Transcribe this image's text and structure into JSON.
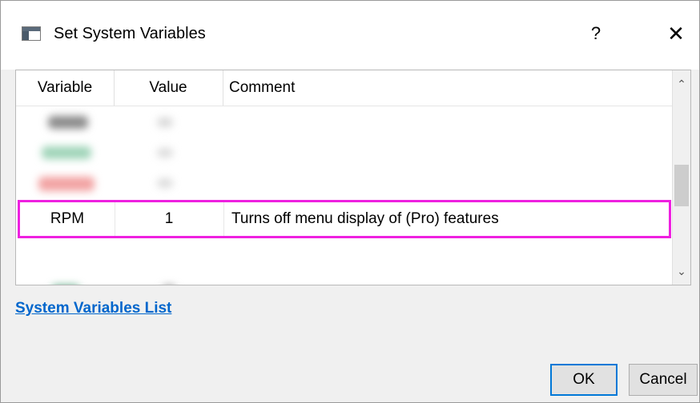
{
  "window": {
    "title": "Set System Variables",
    "help_label": "?",
    "close_label": "✕"
  },
  "table": {
    "columns": [
      "Variable",
      "Value",
      "Comment"
    ],
    "highlighted_row": {
      "variable": "RPM",
      "value": "1",
      "comment": "Turns off menu display of (Pro) features"
    },
    "highlight_color": "#ee20e0"
  },
  "scrollbar": {
    "up_arrow": "⌃",
    "down_arrow": "⌄"
  },
  "link": {
    "label": "System Variables List"
  },
  "buttons": {
    "ok_label": "OK",
    "cancel_label": "Cancel"
  }
}
